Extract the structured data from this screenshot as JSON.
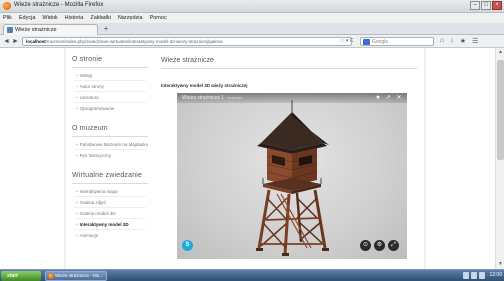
{
  "window": {
    "title": "Wieże strażnicze - Mozilla Firefox",
    "controls": [
      "–",
      "□",
      "×"
    ]
  },
  "menu": [
    "Plik",
    "Edycja",
    "Widok",
    "Historia",
    "Zakładki",
    "Narzędzia",
    "Pomoc"
  ],
  "tab": {
    "label": "Wieże strażnicze",
    "new_tab": "+"
  },
  "nav": {
    "back": "◄",
    "forward": "►",
    "url_host": "localhost",
    "url_path": "/muzeum/index.php/zwiedzanie-wirtualne/interaktywny-model-3d-wiezy-straznicej/galeria",
    "url_icons": "☆ ▾ C",
    "search_placeholder": "Google",
    "right_icons": [
      "⌂",
      "↓",
      "★",
      "☰"
    ]
  },
  "sidebar": {
    "sections": [
      {
        "title": "O stronie",
        "items": [
          "Wstęp",
          "Autor strony",
          "Literatura",
          "Oprogramowanie"
        ]
      },
      {
        "title": "O muzeum",
        "items": [
          "Państwowe Muzeum na Majdanku",
          "Rys historyczny"
        ]
      },
      {
        "title": "Wirtualne zwiedzanie",
        "items": [
          "Interaktywna mapa",
          "Galeria zdjęć",
          "Galeria modeli 3D",
          "Interaktywny model 3D",
          "Animacje"
        ]
      }
    ],
    "active_item": "Interaktywny model 3D"
  },
  "main": {
    "title": "Wieże strażnicze",
    "subtitle": "Interaktywny model 3D wieży strażniczej",
    "viewer": {
      "title": "Wieża strażnicza 1",
      "by": "muzeum",
      "header_icons": [
        "★",
        "↗",
        "✕"
      ],
      "badge": "S",
      "controls": [
        "⊙",
        "⚙",
        "⤢"
      ]
    }
  },
  "taskbar": {
    "start": "start",
    "task": "Wieże strażnicze - Mo...",
    "clock": "12:00"
  }
}
